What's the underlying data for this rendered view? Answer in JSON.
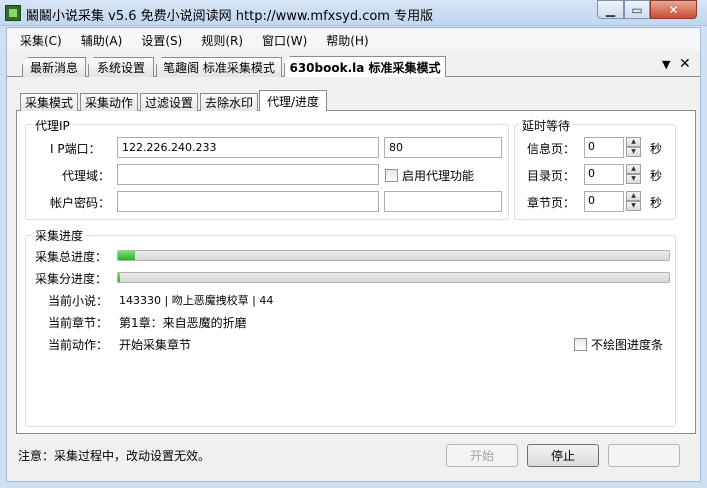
{
  "window": {
    "title": "鬫鬫小说采集 v5.6 免费小说阅读网 http://www.mfxsyd.com 专用版"
  },
  "menu": [
    "采集(C)",
    "辅助(A)",
    "设置(S)",
    "规则(R)",
    "窗口(W)",
    "帮助(H)"
  ],
  "doc_tabs": [
    "最新消息",
    "系统设置",
    "笔趣阁 标准采集模式",
    "630book.la 标准采集模式"
  ],
  "doc_tabs_active": 3,
  "inner_tabs": [
    "采集模式",
    "采集动作",
    "过滤设置",
    "去除水印",
    "代理/进度"
  ],
  "inner_tabs_active": 4,
  "proxy": {
    "group_title": "代理IP",
    "ip_label": "I P端口：",
    "ip_value": "122.226.240.233",
    "port_value": "80",
    "domain_label": "代理域：",
    "domain_value": "",
    "enable_label": "启用代理功能",
    "enable_checked": false,
    "account_label": "帐户密码：",
    "account_value": "",
    "password_value": ""
  },
  "delay": {
    "group_title": "延时等待",
    "unit": "秒",
    "info_label": "信息页：",
    "info_value": "0",
    "toc_label": "目录页：",
    "toc_value": "0",
    "chapter_label": "章节页：",
    "chapter_value": "0"
  },
  "progress": {
    "group_title": "采集进度",
    "total_label": "采集总进度：",
    "total_fraction": 0.03,
    "sub_label": "采集分进度：",
    "sub_fraction": 0.003,
    "novel_label": "当前小说：",
    "novel_value": "143330 | 吻上恶魔拽校草 | 44",
    "chapter_label": "当前章节：",
    "chapter_value": "第1章：来自恶魔的折磨",
    "action_label": "当前动作：",
    "action_value": "开始采集章节",
    "no_draw_label": "不绘图进度条",
    "no_draw_checked": false
  },
  "footer": {
    "note": "注意：采集过程中，改动设置无效。",
    "start_label": "开始",
    "stop_label": "停止"
  },
  "colors": {
    "progress_green": "#24b31f",
    "titlebar": "#c2d6ee"
  }
}
